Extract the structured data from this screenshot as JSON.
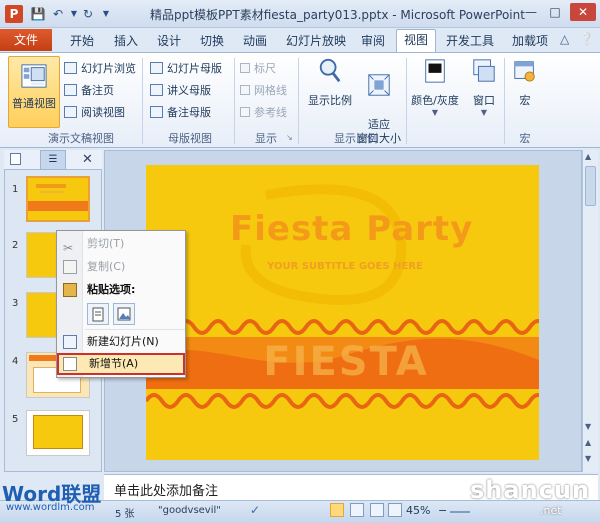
{
  "titlebar": {
    "app_icon": "P",
    "title": "精品ppt模板PPT素材fiesta_party013.pptx - Microsoft PowerPoint",
    "quick_access": [
      "save-icon",
      "undo-icon",
      "dropdown-icon",
      "redo-icon",
      "customize-icon"
    ],
    "window_buttons": [
      "minimize-icon",
      "maximize-icon",
      "close-icon"
    ]
  },
  "tabs": {
    "file": "文件",
    "items": [
      "开始",
      "插入",
      "设计",
      "切换",
      "动画",
      "幻灯片放映",
      "审阅",
      "视图",
      "开发工具",
      "加载项"
    ],
    "active": "视图"
  },
  "ribbon": {
    "groups": [
      {
        "label": "演示文稿视图",
        "big": "普通视图",
        "small": [
          "幻灯片浏览",
          "备注页",
          "阅读视图"
        ]
      },
      {
        "label": "母版视图",
        "small": [
          "幻灯片母版",
          "讲义母版",
          "备注母版"
        ]
      },
      {
        "label": "显示",
        "checkboxes": [
          "标尺",
          "网格线",
          "参考线"
        ]
      },
      {
        "label": "显示比例",
        "big": [
          "显示比例",
          "适应\n窗口大小"
        ]
      },
      {
        "label": "",
        "big": [
          "颜色/灰度",
          "窗口"
        ]
      },
      {
        "label": "宏",
        "big": [
          "宏"
        ]
      }
    ]
  },
  "slides_panel": {
    "thumb_numbers": [
      "1",
      "2",
      "3",
      "4",
      "5"
    ]
  },
  "slide": {
    "title": "Fiesta Party",
    "subtitle": "YOUR SUBTITLE GOES HERE",
    "band_text": "FIESTA",
    "colors": {
      "background": "#f6c90f",
      "title": "#f39a18",
      "band": "#f05a1a"
    }
  },
  "context_menu": {
    "items": [
      {
        "label": "剪切(T)",
        "icon": "scissors-icon",
        "enabled": false
      },
      {
        "label": "复制(C)",
        "icon": "copy-icon",
        "enabled": false
      },
      {
        "label": "粘贴选项:",
        "icon": "paste-icon",
        "enabled": true,
        "bold": true
      },
      {
        "label": "新建幻灯片(N)",
        "icon": "new-slide-icon",
        "enabled": true
      },
      {
        "label": "新增节(A)",
        "icon": "new-section-icon",
        "enabled": true,
        "highlighted": true
      }
    ]
  },
  "notes": {
    "placeholder": "单击此处添加备注"
  },
  "statusbar": {
    "slide_count": "5 张",
    "theme": "\"goodvsevil\"",
    "language_icon": "check-icon",
    "zoom": "45%"
  },
  "watermarks": {
    "left": "Word联盟",
    "left_url": "www.wordlm.com",
    "right": "shancun",
    "right_url": ".net"
  }
}
